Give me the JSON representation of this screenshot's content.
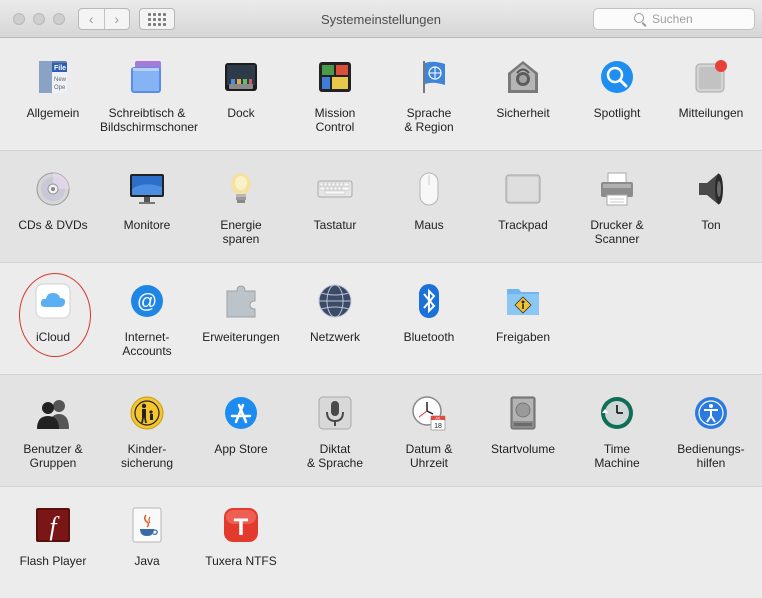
{
  "window": {
    "title": "Systemeinstellungen",
    "back_glyph": "‹",
    "forward_glyph": "›"
  },
  "search": {
    "placeholder": "Suchen"
  },
  "sections": [
    {
      "items": [
        {
          "label": "Allgemein",
          "icon": "general-icon"
        },
        {
          "label": "Schreibtisch &\nBildschirmschoner",
          "icon": "desktop-screensaver-icon"
        },
        {
          "label": "Dock",
          "icon": "dock-icon"
        },
        {
          "label": "Mission\nControl",
          "icon": "mission-control-icon"
        },
        {
          "label": "Sprache\n& Region",
          "icon": "language-region-icon"
        },
        {
          "label": "Sicherheit",
          "icon": "security-icon"
        },
        {
          "label": "Spotlight",
          "icon": "spotlight-icon"
        },
        {
          "label": "Mitteilungen",
          "icon": "notifications-icon"
        }
      ]
    },
    {
      "items": [
        {
          "label": "CDs & DVDs",
          "icon": "cd-dvd-icon"
        },
        {
          "label": "Monitore",
          "icon": "displays-icon"
        },
        {
          "label": "Energie\nsparen",
          "icon": "energy-saver-icon"
        },
        {
          "label": "Tastatur",
          "icon": "keyboard-icon"
        },
        {
          "label": "Maus",
          "icon": "mouse-icon"
        },
        {
          "label": "Trackpad",
          "icon": "trackpad-icon"
        },
        {
          "label": "Drucker &\nScanner",
          "icon": "printer-scanner-icon"
        },
        {
          "label": "Ton",
          "icon": "sound-icon"
        }
      ]
    },
    {
      "items": [
        {
          "label": "iCloud",
          "icon": "icloud-icon"
        },
        {
          "label": "Internet-\nAccounts",
          "icon": "internet-accounts-icon"
        },
        {
          "label": "Erweiterungen",
          "icon": "extensions-icon"
        },
        {
          "label": "Netzwerk",
          "icon": "network-icon"
        },
        {
          "label": "Bluetooth",
          "icon": "bluetooth-icon"
        },
        {
          "label": "Freigaben",
          "icon": "sharing-icon"
        }
      ]
    },
    {
      "items": [
        {
          "label": "Benutzer &\nGruppen",
          "icon": "users-groups-icon"
        },
        {
          "label": "Kinder-\nsicherung",
          "icon": "parental-controls-icon"
        },
        {
          "label": "App Store",
          "icon": "app-store-icon"
        },
        {
          "label": "Diktat\n& Sprache",
          "icon": "dictation-speech-icon"
        },
        {
          "label": "Datum &\nUhrzeit",
          "icon": "date-time-icon"
        },
        {
          "label": "Startvolume",
          "icon": "startup-disk-icon"
        },
        {
          "label": "Time\nMachine",
          "icon": "time-machine-icon"
        },
        {
          "label": "Bedienungs-\nhilfen",
          "icon": "accessibility-icon"
        }
      ]
    },
    {
      "items": [
        {
          "label": "Flash Player",
          "icon": "flash-player-icon"
        },
        {
          "label": "Java",
          "icon": "java-icon"
        },
        {
          "label": "Tuxera NTFS",
          "icon": "tuxera-ntfs-icon"
        }
      ]
    }
  ],
  "icon_text": {
    "general_file": "File",
    "general_new": "New",
    "general_open": "Ope",
    "calendar_month": "JUL",
    "calendar_day": "18",
    "tuxera_letter": "T",
    "flash_letter": "f"
  },
  "colors": {
    "highlight_ring": "#d8372c",
    "notification_badge": "#e8413a",
    "spotlight_blue": "#1e8ef0",
    "accessibility_blue": "#2a7ae0"
  }
}
